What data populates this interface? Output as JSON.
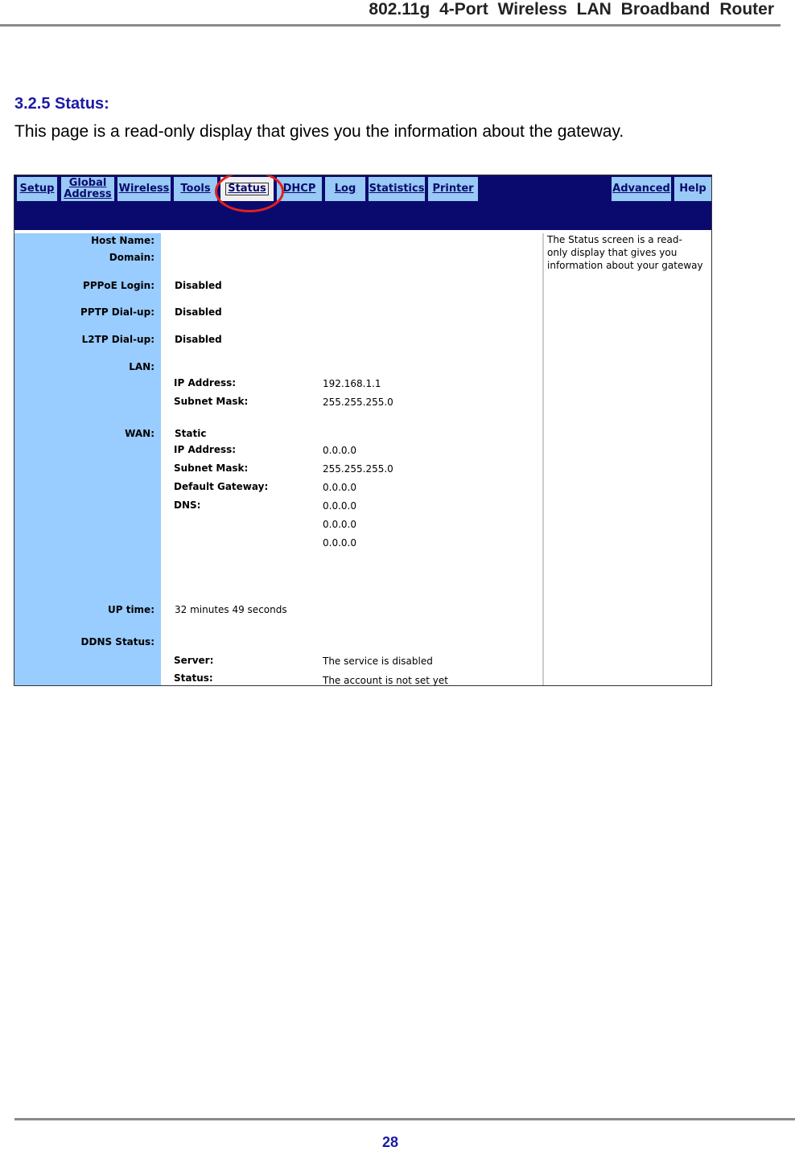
{
  "header": {
    "title": "802.11g  4-Port  Wireless  LAN  Broadband  Router"
  },
  "section": {
    "heading": "3.2.5 Status:",
    "intro": "This page is a read-only display that gives you the information about the gateway."
  },
  "screenshot": {
    "tabs": [
      "Setup",
      "Global Address",
      "Wireless",
      "Tools",
      "Status",
      "DHCP",
      "Log",
      "Statistics",
      "Printer",
      "Advanced",
      "Help"
    ],
    "active_tab": "Status",
    "labels": {
      "host_name": "Host Name:",
      "domain": "Domain:",
      "pppoe": "PPPoE Login:",
      "pptp": "PPTP Dial-up:",
      "l2tp": "L2TP Dial-up:",
      "lan": "LAN:",
      "wan": "WAN:",
      "uptime": "UP time:",
      "ddns": "DDNS Status:"
    },
    "values": {
      "pppoe": "Disabled",
      "pptp": "Disabled",
      "l2tp": "Disabled",
      "lan_ip_label": "IP Address:",
      "lan_ip": "192.168.1.1",
      "lan_mask_label": "Subnet Mask:",
      "lan_mask": "255.255.255.0",
      "wan_type": "Static",
      "wan_ip_label": "IP Address:",
      "wan_ip": "0.0.0.0",
      "wan_mask_label": "Subnet Mask:",
      "wan_mask": "255.255.255.0",
      "wan_gw_label": "Default Gateway:",
      "wan_gw": "0.0.0.0",
      "dns_label": "DNS:",
      "dns": [
        "0.0.0.0",
        "0.0.0.0",
        "0.0.0.0"
      ],
      "uptime": "32 minutes 49 seconds",
      "server_label": "Server:",
      "server": "The service is disabled",
      "status_label": "Status:",
      "status": "The account is not set yet"
    },
    "help": "The Status screen is a read-\nonly display that gives you\ninformation about your gateway"
  },
  "footer": {
    "page_number": "28"
  }
}
